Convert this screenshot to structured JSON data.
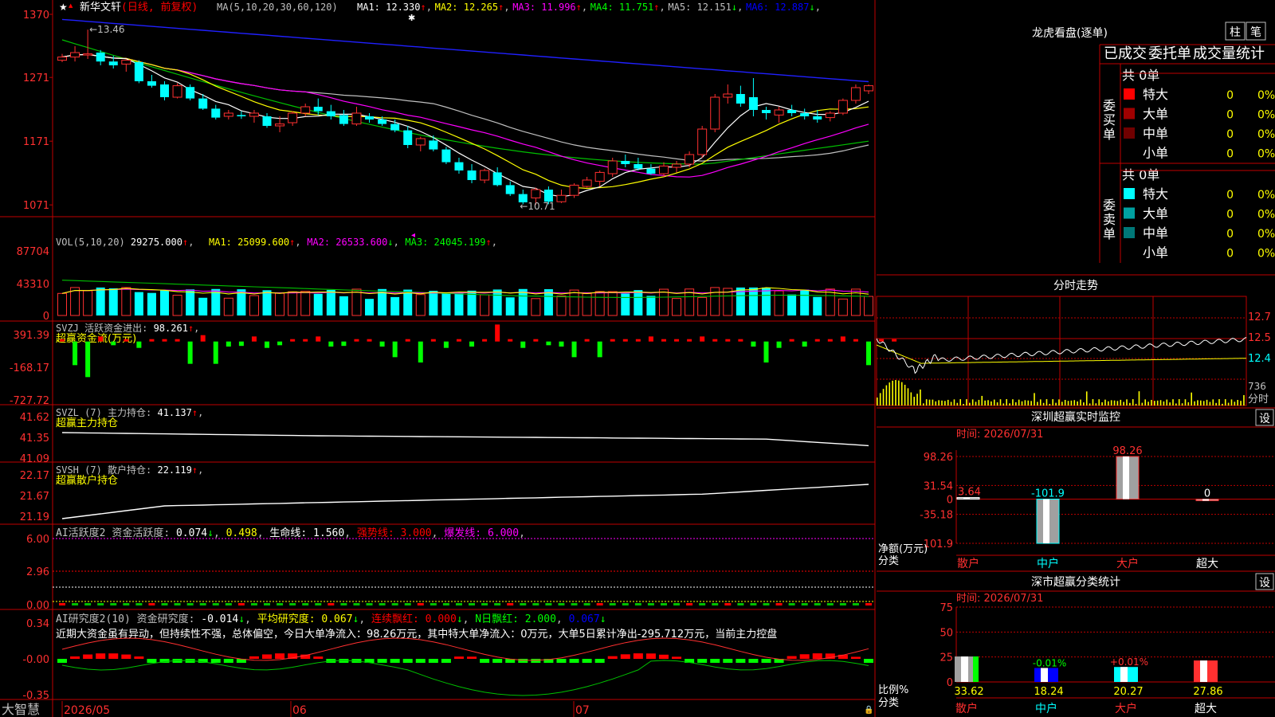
{
  "app": {
    "brand": "大智慧",
    "date_axis": [
      "2026/05",
      "06",
      "07"
    ]
  },
  "kline": {
    "stock": "新华文轩",
    "mode": "(日线, 前复权)",
    "ma_spec": "MA(5,10,20,30,60,120)",
    "ma": [
      {
        "label": "MA1:",
        "value": "12.330",
        "arrow": "↑",
        "color": "#ffffff"
      },
      {
        "label": "MA2:",
        "value": "12.265",
        "arrow": "↑",
        "color": "#ffff00"
      },
      {
        "label": "MA3:",
        "value": "11.996",
        "arrow": "↑",
        "color": "#ff00ff"
      },
      {
        "label": "MA4:",
        "value": "11.751",
        "arrow": "↑",
        "color": "#00ff00"
      },
      {
        "label": "MA5:",
        "value": "12.151",
        "arrow": "↓",
        "color": "#c0c0c0"
      },
      {
        "label": "MA6:",
        "value": "12.887",
        "arrow": "↓",
        "color": "#0000ff"
      }
    ],
    "y_ticks": [
      "1370",
      "1271",
      "1171",
      "1071"
    ],
    "high_label": "13.46",
    "low_label": "10.71",
    "candles": [
      [
        12.98,
        13.08,
        12.95,
        13.03
      ],
      [
        13.03,
        13.2,
        12.96,
        13.1
      ],
      [
        13.08,
        13.46,
        13.0,
        13.08
      ],
      [
        13.1,
        13.14,
        12.9,
        12.96
      ],
      [
        12.96,
        13.05,
        12.85,
        12.9
      ],
      [
        12.92,
        13.0,
        12.8,
        12.98
      ],
      [
        12.95,
        12.98,
        12.62,
        12.65
      ],
      [
        12.65,
        12.75,
        12.55,
        12.58
      ],
      [
        12.6,
        12.65,
        12.35,
        12.4
      ],
      [
        12.4,
        12.62,
        12.38,
        12.58
      ],
      [
        12.56,
        12.6,
        12.35,
        12.38
      ],
      [
        12.38,
        12.45,
        12.2,
        12.22
      ],
      [
        12.22,
        12.28,
        12.05,
        12.08
      ],
      [
        12.1,
        12.2,
        12.05,
        12.15
      ],
      [
        12.12,
        12.18,
        12.06,
        12.1
      ],
      [
        12.1,
        12.2,
        12.0,
        12.15
      ],
      [
        12.1,
        12.15,
        11.92,
        11.95
      ],
      [
        11.95,
        12.1,
        11.85,
        11.98
      ],
      [
        12.0,
        12.18,
        11.95,
        12.15
      ],
      [
        12.15,
        12.3,
        12.1,
        12.25
      ],
      [
        12.25,
        12.38,
        12.12,
        12.18
      ],
      [
        12.18,
        12.28,
        12.05,
        12.1
      ],
      [
        12.12,
        12.2,
        11.95,
        11.98
      ],
      [
        11.98,
        12.25,
        11.95,
        12.15
      ],
      [
        12.1,
        12.15,
        12.0,
        12.05
      ],
      [
        12.05,
        12.1,
        11.95,
        11.98
      ],
      [
        11.98,
        12.05,
        11.85,
        11.88
      ],
      [
        11.88,
        11.95,
        11.6,
        11.65
      ],
      [
        11.65,
        11.78,
        11.55,
        11.75
      ],
      [
        11.72,
        11.8,
        11.55,
        11.58
      ],
      [
        11.58,
        11.62,
        11.35,
        11.38
      ],
      [
        11.38,
        11.45,
        11.2,
        11.25
      ],
      [
        11.25,
        11.35,
        11.05,
        11.1
      ],
      [
        11.1,
        11.28,
        11.05,
        11.25
      ],
      [
        11.22,
        11.3,
        11.0,
        11.02
      ],
      [
        11.02,
        11.08,
        10.85,
        10.88
      ],
      [
        10.88,
        10.95,
        10.72,
        10.75
      ],
      [
        10.82,
        10.98,
        10.71,
        10.95
      ],
      [
        10.95,
        11.0,
        10.72,
        10.76
      ],
      [
        10.76,
        10.95,
        10.74,
        10.86
      ],
      [
        10.86,
        11.05,
        10.82,
        11.02
      ],
      [
        11.0,
        11.15,
        10.98,
        11.1
      ],
      [
        11.08,
        11.25,
        11.0,
        11.22
      ],
      [
        11.2,
        11.45,
        11.15,
        11.4
      ],
      [
        11.4,
        11.5,
        11.3,
        11.35
      ],
      [
        11.35,
        11.45,
        11.25,
        11.28
      ],
      [
        11.28,
        11.35,
        11.18,
        11.2
      ],
      [
        11.2,
        11.38,
        11.15,
        11.32
      ],
      [
        11.3,
        11.4,
        11.22,
        11.35
      ],
      [
        11.35,
        11.55,
        11.3,
        11.5
      ],
      [
        11.5,
        11.95,
        11.45,
        11.9
      ],
      [
        11.9,
        12.45,
        11.85,
        12.4
      ],
      [
        12.4,
        12.6,
        12.3,
        12.45
      ],
      [
        12.45,
        12.58,
        12.25,
        12.3
      ],
      [
        12.4,
        12.7,
        12.1,
        12.2
      ],
      [
        12.2,
        12.25,
        12.05,
        12.15
      ],
      [
        12.12,
        12.25,
        12.0,
        12.2
      ],
      [
        12.2,
        12.28,
        12.1,
        12.15
      ],
      [
        12.15,
        12.22,
        12.05,
        12.1
      ],
      [
        12.1,
        12.2,
        12.0,
        12.05
      ],
      [
        12.08,
        12.18,
        12.02,
        12.15
      ],
      [
        12.15,
        12.38,
        12.12,
        12.35
      ],
      [
        12.35,
        12.6,
        12.3,
        12.55
      ],
      [
        12.5,
        12.6,
        12.45,
        12.58
      ]
    ]
  },
  "volume": {
    "spec": "VOL(5,10,20)",
    "value": "29275.000",
    "value_arrow": "↑",
    "ma": [
      {
        "label": "MA1:",
        "value": "25099.600",
        "arrow": "↑",
        "color": "#ffff00"
      },
      {
        "label": "MA2:",
        "value": "26533.600",
        "arrow": "↓",
        "color": "#ff00ff"
      },
      {
        "label": "MA3:",
        "value": "24045.199",
        "arrow": "↑",
        "color": "#00ff00"
      }
    ],
    "y_ticks": [
      "87704",
      "43310",
      "0"
    ]
  },
  "svzj": {
    "title": "SVZJ",
    "label": "活跃资金进出:",
    "value": "98.261",
    "arrow": "↑",
    "subtitle": "超赢资金流(万元)",
    "y_ticks": [
      "391.39",
      "-168.17",
      "-727.72"
    ],
    "bars": [
      0,
      -320,
      -500,
      40,
      -20,
      0,
      -60,
      0,
      0,
      0,
      -300,
      60,
      -300,
      -40,
      -30,
      40,
      -60,
      -20,
      0,
      0,
      40,
      -40,
      -30,
      0,
      0,
      -40,
      -200,
      0,
      -280,
      0,
      -60,
      0,
      -40,
      0,
      220,
      0,
      -60,
      0,
      -20,
      -40,
      -200,
      0,
      -200,
      0,
      0,
      0,
      40,
      0,
      0,
      0,
      40,
      0,
      0,
      0,
      -40,
      -280,
      -60,
      0,
      -40,
      0,
      0,
      40,
      0,
      -320,
      0,
      0
    ]
  },
  "svzl": {
    "title": "SVZL (7)",
    "label": "主力持仓:",
    "value": "41.137",
    "arrow": "↑",
    "subtitle": "超赢主力持仓",
    "y_ticks": [
      "41.62",
      "41.35",
      "41.09"
    ]
  },
  "svsh": {
    "title": "SVSH (7)",
    "label": "散户持仓:",
    "value": "22.119",
    "arrow": "↑",
    "subtitle": "超赢散户持仓",
    "y_ticks": [
      "22.17",
      "21.67",
      "21.19"
    ]
  },
  "ai_active": {
    "title": "AI活跃度2",
    "label1": "资金活跃度:",
    "v1": "0.074",
    "a1": "↓",
    "v2": "0.498",
    "label2": "生命线:",
    "v3": "1.560",
    "label3": "强势线:",
    "v4": "3.000",
    "label4": "爆发线:",
    "v5": "6.000",
    "y_ticks": [
      "6.00",
      "2.96",
      "0.00"
    ]
  },
  "ai_research": {
    "title": "AI研究度2(10)",
    "label1": "资金研究度:",
    "v1": "-0.014",
    "a1": "↓",
    "label2": "平均研究度:",
    "v2": "0.067",
    "a2": "↓",
    "label3": "连续飘红:",
    "v3": "0.000",
    "a3": "↓",
    "label4": "N日飘红:",
    "v4": "2.000",
    "v5": "0.067",
    "a5": "↓",
    "comment": "近期大资金虽有异动，但持续性不强，总体偏空，今日大单净流入：98.26万元，其中特大单净流入：0万元，大单5日累计净出-295.712万元，当前主力控盘",
    "y_ticks": [
      "0.34",
      "-0.00",
      "-0.35"
    ]
  },
  "dragon": {
    "title": "龙虎看盘(逐单)",
    "btn_zhu": "柱",
    "btn_bi": "笔",
    "tabs": [
      "已成交",
      "委托单",
      "成交量统计"
    ],
    "buy": {
      "side_label": "委买单",
      "count": "共 0单",
      "rows": [
        {
          "name": "特大",
          "num": "0",
          "pct": "0%",
          "color": "#ff0000"
        },
        {
          "name": "大单",
          "num": "0",
          "pct": "0%",
          "color": "#a00000"
        },
        {
          "name": "中单",
          "num": "0",
          "pct": "0%",
          "color": "#700000"
        },
        {
          "name": "小单",
          "num": "0",
          "pct": "0%",
          "color": ""
        }
      ]
    },
    "sell": {
      "side_label": "委卖单",
      "count": "共 0单",
      "rows": [
        {
          "name": "特大",
          "num": "0",
          "pct": "0%",
          "color": "#00ffff"
        },
        {
          "name": "大单",
          "num": "0",
          "pct": "0%",
          "color": "#00a0a0"
        },
        {
          "name": "中单",
          "num": "0",
          "pct": "0%",
          "color": "#007878"
        },
        {
          "name": "小单",
          "num": "0",
          "pct": "0%",
          "color": ""
        }
      ]
    }
  },
  "intraday": {
    "title": "分时走势",
    "y_ticks": [
      "12.7",
      "12.5",
      "12.4"
    ],
    "vol_label": "736",
    "vol_unit": "分时"
  },
  "sz_monitor": {
    "title": "深圳超赢实时监控",
    "btn": "设",
    "time_label": "时间: 2026/07/31",
    "y_ticks": [
      "98.26",
      "31.54",
      "0",
      "-35.18",
      "-101.9"
    ],
    "axis_label": "净额(万元)",
    "cat_label": "分类",
    "categories": [
      "散户",
      "中户",
      "大户",
      "超大"
    ],
    "values": [
      3.64,
      -101.9,
      98.26,
      0
    ],
    "value_labels": [
      "3.64",
      "-101.9",
      "98.26",
      "0"
    ]
  },
  "sz_class": {
    "title": "深市超赢分类统计",
    "btn": "设",
    "time_label": "时间: 2026/07/31",
    "y_ticks": [
      "75",
      "50",
      "25",
      "0"
    ],
    "axis_label": "比例%",
    "cat_label": "分类",
    "categories": [
      "散户",
      "中户",
      "大户",
      "超大"
    ],
    "values": [
      33.62,
      18.24,
      20.27,
      27.86
    ],
    "delta_labels": [
      "",
      "-0.01%",
      "+0.01%",
      ""
    ]
  },
  "chart_data": [
    {
      "type": "bar",
      "title": "深圳超赢实时监控",
      "ylabel": "净额(万元)",
      "categories": [
        "散户",
        "中户",
        "大户",
        "超大"
      ],
      "values": [
        3.64,
        -101.9,
        98.26,
        0
      ],
      "ylim": [
        -101.9,
        98.26
      ]
    },
    {
      "type": "bar",
      "title": "深市超赢分类统计",
      "ylabel": "比例%",
      "categories": [
        "散户",
        "中户",
        "大户",
        "超大"
      ],
      "values": [
        33.62,
        18.24,
        20.27,
        27.86
      ],
      "ylim": [
        0,
        75
      ]
    }
  ]
}
